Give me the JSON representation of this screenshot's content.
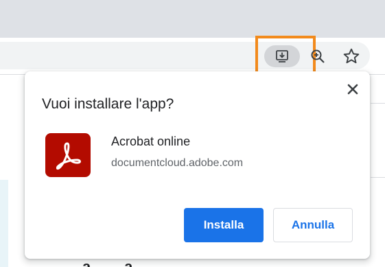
{
  "browser": {
    "toolbar_icons": [
      "install-app-icon",
      "zoom-icon",
      "star-icon"
    ],
    "highlight_color": "#f28a1c"
  },
  "page": {
    "partial_text": "a ...... a"
  },
  "dialog": {
    "title": "Vuoi installare l'app?",
    "close_icon": "close-icon",
    "app": {
      "icon": "acrobat-logo-icon",
      "icon_color": "#b30b00",
      "name": "Acrobat online",
      "origin": "documentcloud.adobe.com"
    },
    "buttons": {
      "install_label": "Installa",
      "cancel_label": "Annulla"
    },
    "accent_color": "#1a73e8"
  }
}
